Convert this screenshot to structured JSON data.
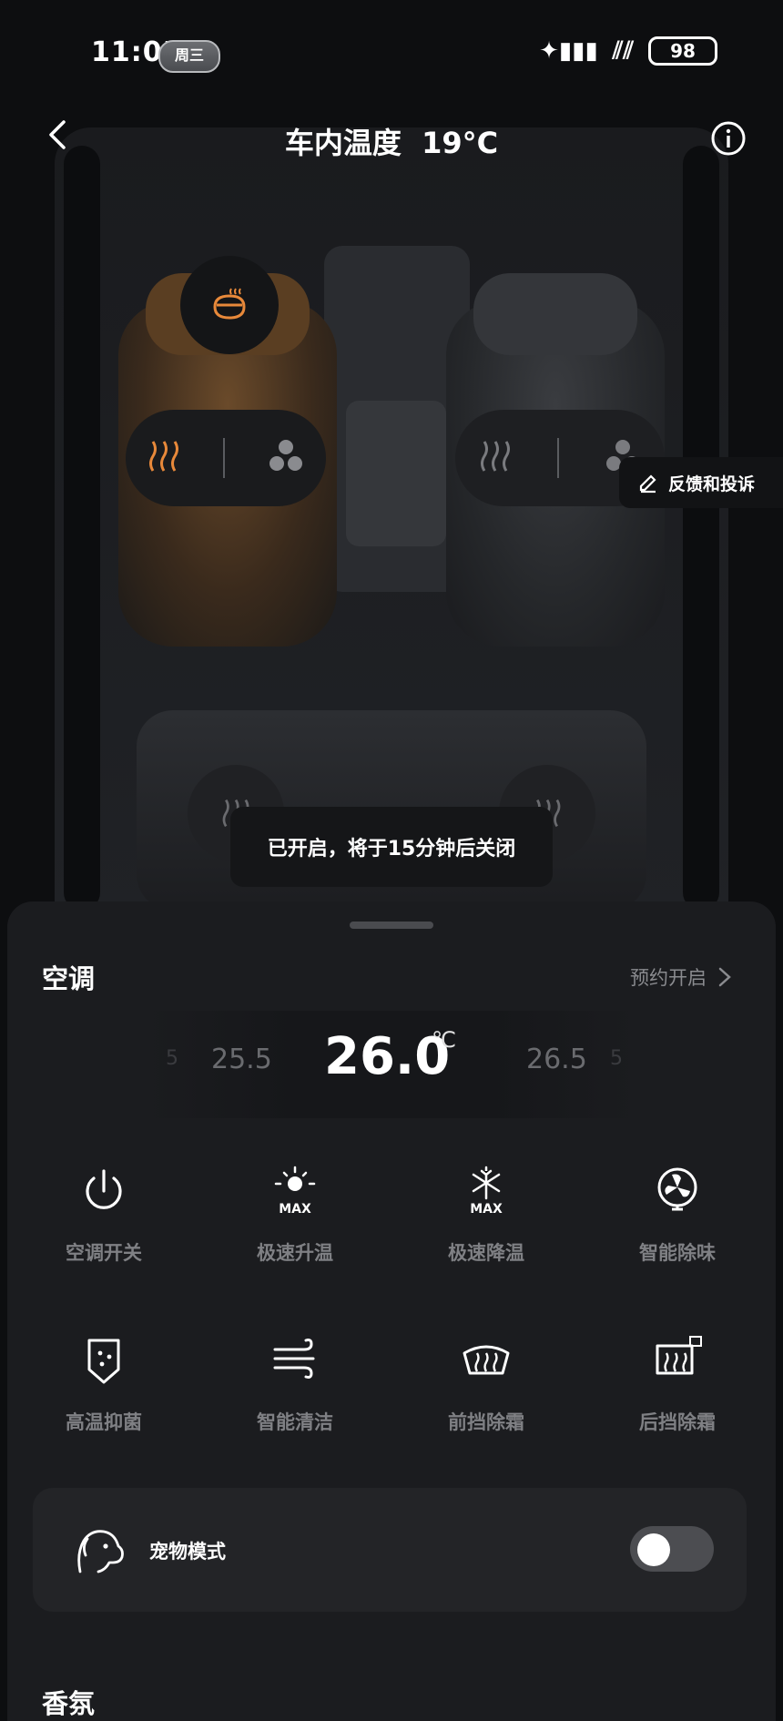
{
  "status_bar": {
    "time": "11:05",
    "day": "周三",
    "battery": "98"
  },
  "header": {
    "title": "车内温度  19°C"
  },
  "feedback": {
    "label": "反馈和投诉"
  },
  "toast": {
    "text": "已开启，将于15分钟后关闭"
  },
  "climate": {
    "section_title": "空调",
    "schedule_label": "预约开启",
    "temperature": {
      "current": "26.0",
      "unit": "℃",
      "prev": "25.5",
      "next": "26.5",
      "edge_left": "5",
      "edge_right": "5"
    },
    "actions": [
      {
        "label": "空调开关",
        "icon": "power-icon"
      },
      {
        "label": "极速升温",
        "icon": "sun-max-icon"
      },
      {
        "label": "极速降温",
        "icon": "snowflake-max-icon"
      },
      {
        "label": "智能除味",
        "icon": "fan-icon"
      },
      {
        "label": "高温抑菌",
        "icon": "shield-dots-icon"
      },
      {
        "label": "智能清洁",
        "icon": "wind-icon"
      },
      {
        "label": "前挡除霜",
        "icon": "front-defrost-icon"
      },
      {
        "label": "后挡除霜",
        "icon": "rear-defrost-icon"
      }
    ],
    "pet_mode": {
      "label": "宠物模式",
      "enabled": false
    }
  },
  "next_section": {
    "title": "香氛"
  },
  "colors": {
    "accent": "#e8893a",
    "background": "#0d0e10",
    "sheet": "#1b1c1f"
  }
}
